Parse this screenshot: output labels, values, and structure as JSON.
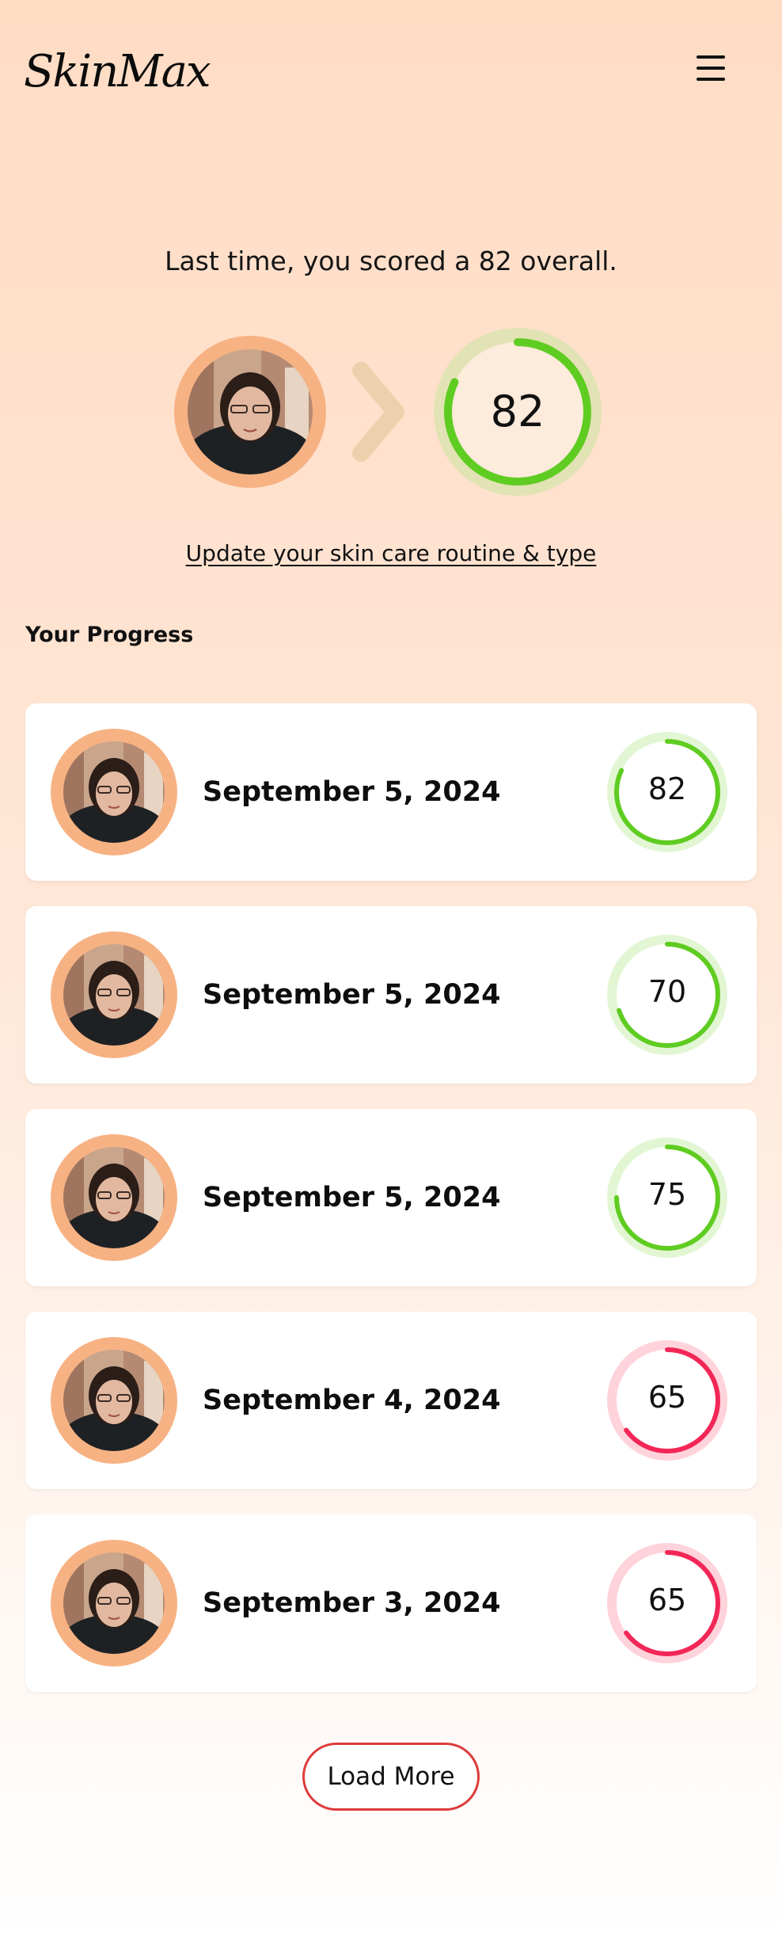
{
  "header": {
    "logo": "SkinMax",
    "menu_icon": "hamburger-menu-icon"
  },
  "hero": {
    "message": "Last time, you scored a 82 overall.",
    "score": 82,
    "score_label": "82",
    "arrow_icon": "chevron-right-icon",
    "update_link": "Update your skin care routine & type"
  },
  "progress": {
    "heading": "Your Progress",
    "entries": [
      {
        "date": "September 5, 2024",
        "score": 82,
        "score_label": "82",
        "status": "good"
      },
      {
        "date": "September 5, 2024",
        "score": 70,
        "score_label": "70",
        "status": "good"
      },
      {
        "date": "September 5, 2024",
        "score": 75,
        "score_label": "75",
        "status": "good"
      },
      {
        "date": "September 4, 2024",
        "score": 65,
        "score_label": "65",
        "status": "bad"
      },
      {
        "date": "September 3, 2024",
        "score": 65,
        "score_label": "65",
        "status": "bad"
      }
    ]
  },
  "load_more": "Load More",
  "colors": {
    "accent_good": "#5fcc21",
    "accent_good_track": "#e2f6d4",
    "hero_track": "#e2e3b4",
    "accent_bad": "#f22757",
    "accent_bad_track": "#ffd3db",
    "avatar_ring": "#f7b283",
    "button_border": "#dd3b3b"
  }
}
